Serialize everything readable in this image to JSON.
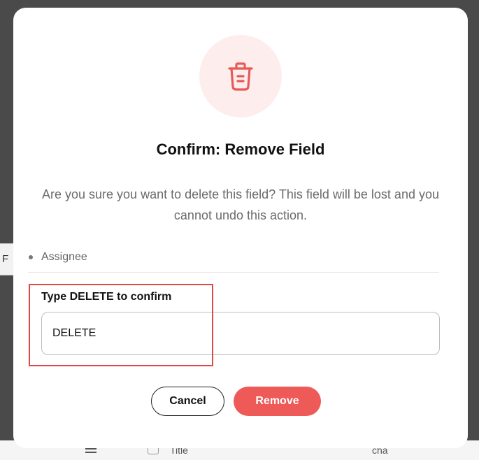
{
  "background": {
    "filter_button_label": "F",
    "row": {
      "title_cell": "Title",
      "other_cell": "cha"
    }
  },
  "modal": {
    "icon": "trash-icon",
    "title": "Confirm: Remove Field",
    "description": "Are you sure you want to delete this field? This field will be lost and you cannot undo this action.",
    "fields": [
      "Assignee"
    ],
    "confirm_label": "Type DELETE to confirm",
    "confirm_value": "DELETE",
    "cancel_label": "Cancel",
    "remove_label": "Remove"
  },
  "colors": {
    "accent_danger": "#ee5a58",
    "icon_bg": "#fdeeed",
    "highlight": "#e04848"
  }
}
